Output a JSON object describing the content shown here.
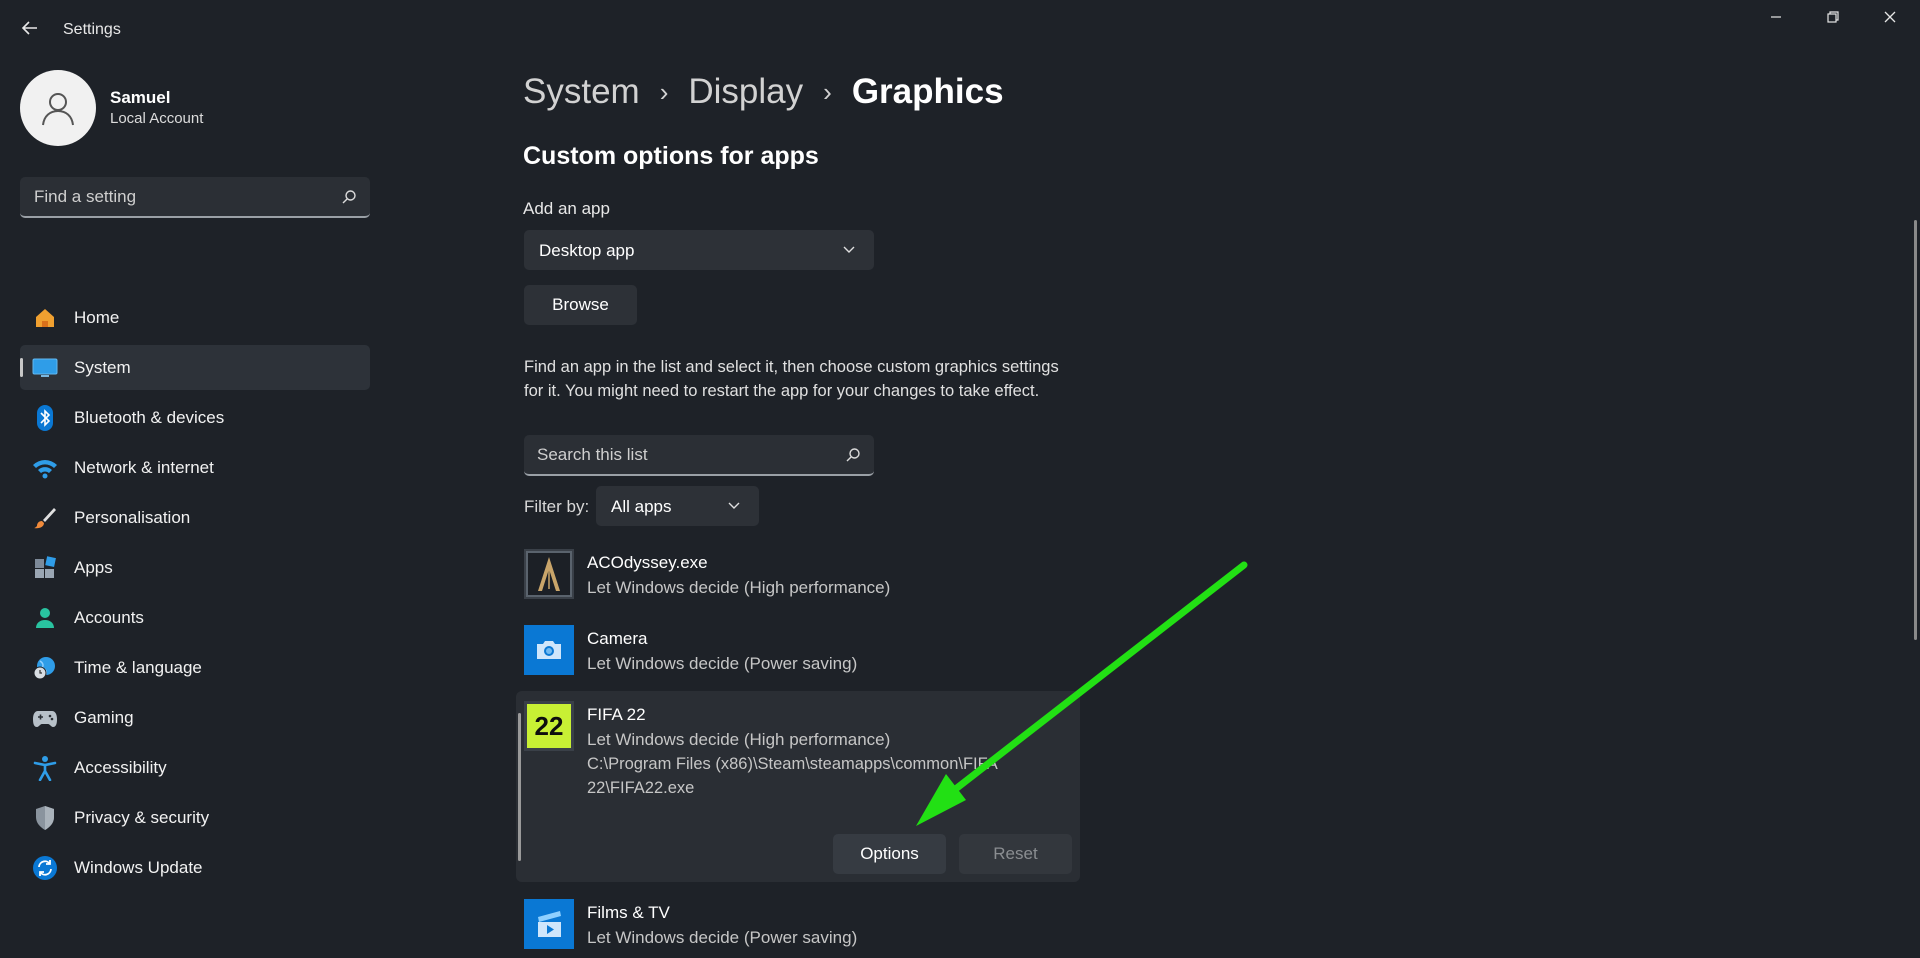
{
  "window": {
    "title": "Settings",
    "controls": {
      "minimize": "—",
      "maximize": "❐",
      "close": "✕"
    }
  },
  "profile": {
    "name": "Samuel",
    "account_type": "Local Account"
  },
  "sidebar": {
    "search_placeholder": "Find a setting",
    "items": [
      {
        "label": "Home",
        "icon": "home-icon",
        "active": false
      },
      {
        "label": "System",
        "icon": "system-icon",
        "active": true
      },
      {
        "label": "Bluetooth & devices",
        "icon": "bluetooth-icon",
        "active": false
      },
      {
        "label": "Network & internet",
        "icon": "wifi-icon",
        "active": false
      },
      {
        "label": "Personalisation",
        "icon": "brush-icon",
        "active": false
      },
      {
        "label": "Apps",
        "icon": "apps-icon",
        "active": false
      },
      {
        "label": "Accounts",
        "icon": "accounts-icon",
        "active": false
      },
      {
        "label": "Time & language",
        "icon": "globe-clock-icon",
        "active": false
      },
      {
        "label": "Gaming",
        "icon": "gamepad-icon",
        "active": false
      },
      {
        "label": "Accessibility",
        "icon": "accessibility-icon",
        "active": false
      },
      {
        "label": "Privacy & security",
        "icon": "shield-icon",
        "active": false
      },
      {
        "label": "Windows Update",
        "icon": "update-icon",
        "active": false
      }
    ]
  },
  "breadcrumb": {
    "items": [
      "System",
      "Display",
      "Graphics"
    ],
    "separator": "›"
  },
  "main": {
    "section_title": "Custom options for apps",
    "add_app_label": "Add an app",
    "add_app_selected": "Desktop app",
    "browse_label": "Browse",
    "description": "Find an app in the list and select it, then choose custom graphics settings for it. You might need to restart the app for your changes to take effect.",
    "search_placeholder": "Search this list",
    "filter_label": "Filter by:",
    "filter_selected": "All apps",
    "apps": [
      {
        "name": "ACOdyssey.exe",
        "setting": "Let Windows decide (High performance)",
        "icon": "ac-odyssey-icon"
      },
      {
        "name": "Camera",
        "setting": "Let Windows decide (Power saving)",
        "icon": "camera-icon"
      },
      {
        "name": "FIFA 22",
        "setting": "Let Windows decide (High performance)",
        "path": "C:\\Program Files (x86)\\Steam\\steamapps\\common\\FIFA 22\\FIFA22.exe",
        "icon": "fifa-22-icon",
        "icon_text": "22",
        "expanded": true
      },
      {
        "name": "Films & TV",
        "setting": "Let Windows decide (Power saving)",
        "icon": "films-tv-icon"
      }
    ],
    "options_label": "Options",
    "reset_label": "Reset"
  },
  "colors": {
    "background": "#1e2228",
    "accent_blue": "#0a78d4",
    "annotation_arrow": "#22e014",
    "fifa_tile": "#c8f034"
  }
}
